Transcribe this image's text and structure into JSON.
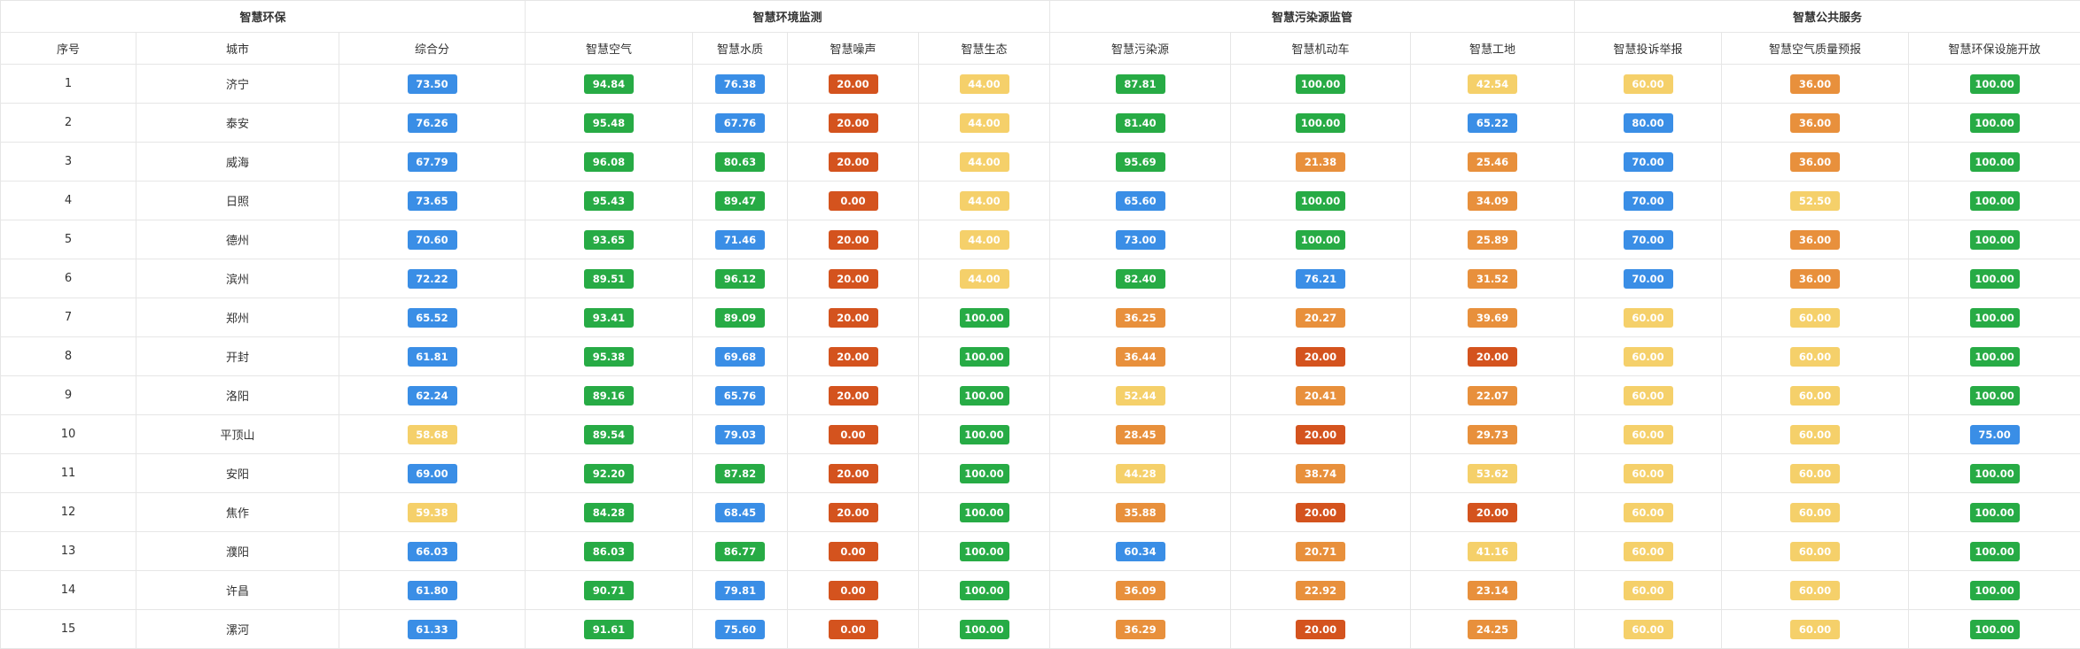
{
  "groups": [
    {
      "label": "智慧环保",
      "span": 3
    },
    {
      "label": "智慧环境监测",
      "span": 4
    },
    {
      "label": "智慧污染源监管",
      "span": 3
    },
    {
      "label": "智慧公共服务",
      "span": 3
    }
  ],
  "columns": [
    "序号",
    "城市",
    "综合分",
    "智慧空气",
    "智慧水质",
    "智慧噪声",
    "智慧生态",
    "智慧污染源",
    "智慧机动车",
    "智慧工地",
    "智慧投诉举报",
    "智慧空气质量预报",
    "智慧环保设施开放"
  ],
  "colors": {
    "green": "#27ab45",
    "blue": "#3a8ee6",
    "red": "#d4531e",
    "orange": "#e8903c",
    "yellow": "#f5d06a"
  },
  "rows": [
    {
      "no": "1",
      "city": "济宁",
      "scores": [
        [
          "73.50",
          "blue"
        ],
        [
          "94.84",
          "green"
        ],
        [
          "76.38",
          "blue"
        ],
        [
          "20.00",
          "red"
        ],
        [
          "44.00",
          "yellow"
        ],
        [
          "87.81",
          "green"
        ],
        [
          "100.00",
          "green"
        ],
        [
          "42.54",
          "yellow"
        ],
        [
          "60.00",
          "yellow"
        ],
        [
          "36.00",
          "orange"
        ],
        [
          "100.00",
          "green"
        ]
      ]
    },
    {
      "no": "2",
      "city": "泰安",
      "scores": [
        [
          "76.26",
          "blue"
        ],
        [
          "95.48",
          "green"
        ],
        [
          "67.76",
          "blue"
        ],
        [
          "20.00",
          "red"
        ],
        [
          "44.00",
          "yellow"
        ],
        [
          "81.40",
          "green"
        ],
        [
          "100.00",
          "green"
        ],
        [
          "65.22",
          "blue"
        ],
        [
          "80.00",
          "blue"
        ],
        [
          "36.00",
          "orange"
        ],
        [
          "100.00",
          "green"
        ]
      ]
    },
    {
      "no": "3",
      "city": "威海",
      "scores": [
        [
          "67.79",
          "blue"
        ],
        [
          "96.08",
          "green"
        ],
        [
          "80.63",
          "green"
        ],
        [
          "20.00",
          "red"
        ],
        [
          "44.00",
          "yellow"
        ],
        [
          "95.69",
          "green"
        ],
        [
          "21.38",
          "orange"
        ],
        [
          "25.46",
          "orange"
        ],
        [
          "70.00",
          "blue"
        ],
        [
          "36.00",
          "orange"
        ],
        [
          "100.00",
          "green"
        ]
      ]
    },
    {
      "no": "4",
      "city": "日照",
      "scores": [
        [
          "73.65",
          "blue"
        ],
        [
          "95.43",
          "green"
        ],
        [
          "89.47",
          "green"
        ],
        [
          "0.00",
          "red"
        ],
        [
          "44.00",
          "yellow"
        ],
        [
          "65.60",
          "blue"
        ],
        [
          "100.00",
          "green"
        ],
        [
          "34.09",
          "orange"
        ],
        [
          "70.00",
          "blue"
        ],
        [
          "52.50",
          "yellow"
        ],
        [
          "100.00",
          "green"
        ]
      ]
    },
    {
      "no": "5",
      "city": "德州",
      "scores": [
        [
          "70.60",
          "blue"
        ],
        [
          "93.65",
          "green"
        ],
        [
          "71.46",
          "blue"
        ],
        [
          "20.00",
          "red"
        ],
        [
          "44.00",
          "yellow"
        ],
        [
          "73.00",
          "blue"
        ],
        [
          "100.00",
          "green"
        ],
        [
          "25.89",
          "orange"
        ],
        [
          "70.00",
          "blue"
        ],
        [
          "36.00",
          "orange"
        ],
        [
          "100.00",
          "green"
        ]
      ]
    },
    {
      "no": "6",
      "city": "滨州",
      "scores": [
        [
          "72.22",
          "blue"
        ],
        [
          "89.51",
          "green"
        ],
        [
          "96.12",
          "green"
        ],
        [
          "20.00",
          "red"
        ],
        [
          "44.00",
          "yellow"
        ],
        [
          "82.40",
          "green"
        ],
        [
          "76.21",
          "blue"
        ],
        [
          "31.52",
          "orange"
        ],
        [
          "70.00",
          "blue"
        ],
        [
          "36.00",
          "orange"
        ],
        [
          "100.00",
          "green"
        ]
      ]
    },
    {
      "no": "7",
      "city": "郑州",
      "scores": [
        [
          "65.52",
          "blue"
        ],
        [
          "93.41",
          "green"
        ],
        [
          "89.09",
          "green"
        ],
        [
          "20.00",
          "red"
        ],
        [
          "100.00",
          "green"
        ],
        [
          "36.25",
          "orange"
        ],
        [
          "20.27",
          "orange"
        ],
        [
          "39.69",
          "orange"
        ],
        [
          "60.00",
          "yellow"
        ],
        [
          "60.00",
          "yellow"
        ],
        [
          "100.00",
          "green"
        ]
      ]
    },
    {
      "no": "8",
      "city": "开封",
      "scores": [
        [
          "61.81",
          "blue"
        ],
        [
          "95.38",
          "green"
        ],
        [
          "69.68",
          "blue"
        ],
        [
          "20.00",
          "red"
        ],
        [
          "100.00",
          "green"
        ],
        [
          "36.44",
          "orange"
        ],
        [
          "20.00",
          "red"
        ],
        [
          "20.00",
          "red"
        ],
        [
          "60.00",
          "yellow"
        ],
        [
          "60.00",
          "yellow"
        ],
        [
          "100.00",
          "green"
        ]
      ]
    },
    {
      "no": "9",
      "city": "洛阳",
      "scores": [
        [
          "62.24",
          "blue"
        ],
        [
          "89.16",
          "green"
        ],
        [
          "65.76",
          "blue"
        ],
        [
          "20.00",
          "red"
        ],
        [
          "100.00",
          "green"
        ],
        [
          "52.44",
          "yellow"
        ],
        [
          "20.41",
          "orange"
        ],
        [
          "22.07",
          "orange"
        ],
        [
          "60.00",
          "yellow"
        ],
        [
          "60.00",
          "yellow"
        ],
        [
          "100.00",
          "green"
        ]
      ]
    },
    {
      "no": "10",
      "city": "平顶山",
      "scores": [
        [
          "58.68",
          "yellow"
        ],
        [
          "89.54",
          "green"
        ],
        [
          "79.03",
          "blue"
        ],
        [
          "0.00",
          "red"
        ],
        [
          "100.00",
          "green"
        ],
        [
          "28.45",
          "orange"
        ],
        [
          "20.00",
          "red"
        ],
        [
          "29.73",
          "orange"
        ],
        [
          "60.00",
          "yellow"
        ],
        [
          "60.00",
          "yellow"
        ],
        [
          "75.00",
          "blue"
        ]
      ]
    },
    {
      "no": "11",
      "city": "安阳",
      "scores": [
        [
          "69.00",
          "blue"
        ],
        [
          "92.20",
          "green"
        ],
        [
          "87.82",
          "green"
        ],
        [
          "20.00",
          "red"
        ],
        [
          "100.00",
          "green"
        ],
        [
          "44.28",
          "yellow"
        ],
        [
          "38.74",
          "orange"
        ],
        [
          "53.62",
          "yellow"
        ],
        [
          "60.00",
          "yellow"
        ],
        [
          "60.00",
          "yellow"
        ],
        [
          "100.00",
          "green"
        ]
      ]
    },
    {
      "no": "12",
      "city": "焦作",
      "scores": [
        [
          "59.38",
          "yellow"
        ],
        [
          "84.28",
          "green"
        ],
        [
          "68.45",
          "blue"
        ],
        [
          "20.00",
          "red"
        ],
        [
          "100.00",
          "green"
        ],
        [
          "35.88",
          "orange"
        ],
        [
          "20.00",
          "red"
        ],
        [
          "20.00",
          "red"
        ],
        [
          "60.00",
          "yellow"
        ],
        [
          "60.00",
          "yellow"
        ],
        [
          "100.00",
          "green"
        ]
      ]
    },
    {
      "no": "13",
      "city": "濮阳",
      "scores": [
        [
          "66.03",
          "blue"
        ],
        [
          "86.03",
          "green"
        ],
        [
          "86.77",
          "green"
        ],
        [
          "0.00",
          "red"
        ],
        [
          "100.00",
          "green"
        ],
        [
          "60.34",
          "blue"
        ],
        [
          "20.71",
          "orange"
        ],
        [
          "41.16",
          "yellow"
        ],
        [
          "60.00",
          "yellow"
        ],
        [
          "60.00",
          "yellow"
        ],
        [
          "100.00",
          "green"
        ]
      ]
    },
    {
      "no": "14",
      "city": "许昌",
      "scores": [
        [
          "61.80",
          "blue"
        ],
        [
          "90.71",
          "green"
        ],
        [
          "79.81",
          "blue"
        ],
        [
          "0.00",
          "red"
        ],
        [
          "100.00",
          "green"
        ],
        [
          "36.09",
          "orange"
        ],
        [
          "22.92",
          "orange"
        ],
        [
          "23.14",
          "orange"
        ],
        [
          "60.00",
          "yellow"
        ],
        [
          "60.00",
          "yellow"
        ],
        [
          "100.00",
          "green"
        ]
      ]
    },
    {
      "no": "15",
      "city": "漯河",
      "scores": [
        [
          "61.33",
          "blue"
        ],
        [
          "91.61",
          "green"
        ],
        [
          "75.60",
          "blue"
        ],
        [
          "0.00",
          "red"
        ],
        [
          "100.00",
          "green"
        ],
        [
          "36.29",
          "orange"
        ],
        [
          "20.00",
          "red"
        ],
        [
          "24.25",
          "orange"
        ],
        [
          "60.00",
          "yellow"
        ],
        [
          "60.00",
          "yellow"
        ],
        [
          "100.00",
          "green"
        ]
      ]
    }
  ]
}
